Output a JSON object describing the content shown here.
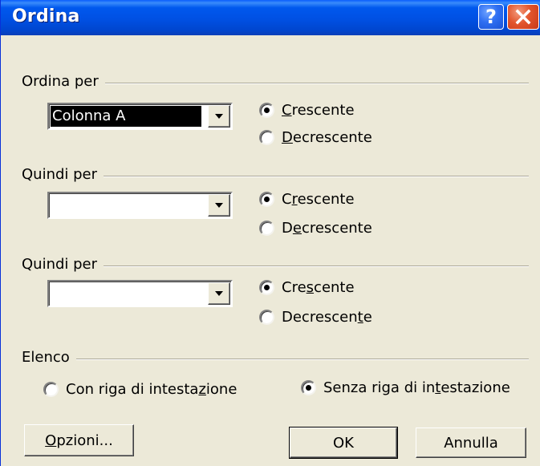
{
  "window": {
    "title": "Ordina"
  },
  "titlebar_buttons": {
    "help": "?"
  },
  "sort_by": {
    "group_label": "Ordina per",
    "field_value": "Colonna A",
    "ascending": {
      "pre": "",
      "mnemonic": "C",
      "post": "rescente",
      "checked": true
    },
    "descending": {
      "pre": "",
      "mnemonic": "D",
      "post": "ecrescente",
      "checked": false
    }
  },
  "then_by_1": {
    "group_label": "Quindi per",
    "field_value": "",
    "ascending": {
      "pre": "C",
      "mnemonic": "r",
      "post": "escente",
      "checked": true
    },
    "descending": {
      "pre": "D",
      "mnemonic": "e",
      "post": "crescente",
      "checked": false
    }
  },
  "then_by_2": {
    "group_label": "Quindi per",
    "field_value": "",
    "ascending": {
      "pre": "Cre",
      "mnemonic": "s",
      "post": "cente",
      "checked": true
    },
    "descending": {
      "pre": "Decrescen",
      "mnemonic": "t",
      "post": "e",
      "checked": false
    }
  },
  "list": {
    "group_label": "Elenco",
    "with_header": {
      "pre": "Con riga di intesta",
      "mnemonic": "z",
      "post": "ione",
      "checked": false
    },
    "without_header": {
      "pre": "Senza riga di in",
      "mnemonic": "t",
      "post": "estazione",
      "checked": true
    }
  },
  "buttons": {
    "options": {
      "mnemonic": "O",
      "post": "pzioni..."
    },
    "ok": "OK",
    "cancel": "Annulla"
  }
}
